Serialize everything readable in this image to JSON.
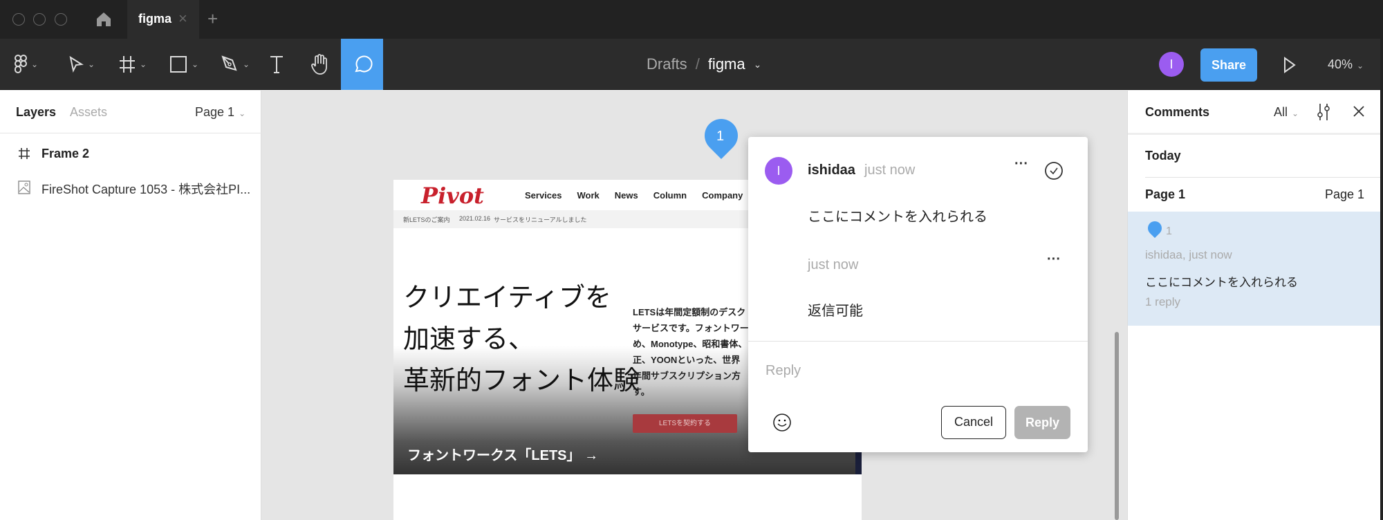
{
  "tabbar": {
    "tab_title": "figma",
    "close": "×",
    "new_tab": "+"
  },
  "toolbar": {
    "breadcrumb_parent": "Drafts",
    "separator": "/",
    "file_name": "figma",
    "avatar_initial": "I",
    "share_label": "Share",
    "zoom": "40%",
    "accent": "#4a9ff0",
    "avatar_color": "#9b5cf0"
  },
  "left_panel": {
    "tabs": [
      "Layers",
      "Assets"
    ],
    "page_selector": "Page 1",
    "layers": [
      {
        "icon": "frame-icon",
        "name": "Frame 2"
      },
      {
        "icon": "image-icon",
        "name": "FireShot Capture 1053 - 株式会社PI..."
      }
    ]
  },
  "canvas": {
    "pin_number": "1",
    "webpage": {
      "logo": "Pivot",
      "nav": [
        "Services",
        "Work",
        "News",
        "Column",
        "Company"
      ],
      "news_label": "新LETSのご案内",
      "news_date": "2021.02.16",
      "news_text": "サービスをリニューアルしました",
      "hero_lines": [
        "クリエイティブを",
        "加速する、",
        "革新的フォント体験"
      ],
      "body_lines": [
        "LETSは年間定額制のデスク",
        "サービスです。フォントワー",
        "め、Monotype、昭和書体、",
        "正、YOONといった、世界",
        "年間サブスクリプション方",
        "す。"
      ],
      "cta": "LETSを契約する",
      "banner": "フォントワークス「LETS」 →"
    }
  },
  "comment_popup": {
    "author": "ishidaa",
    "author_initial": "I",
    "time": "just now",
    "comment": "ここにコメントを入れられる",
    "reply_time": "just now",
    "reply_text": "返信可能",
    "reply_placeholder": "Reply",
    "cancel_label": "Cancel",
    "reply_label": "Reply"
  },
  "comments_panel": {
    "title": "Comments",
    "filter": "All",
    "section": "Today",
    "page_left": "Page 1",
    "page_right": "Page 1",
    "thread": {
      "number": "1",
      "meta": "ishidaa, just now",
      "text": "ここにコメントを入れられる",
      "replies": "1 reply"
    }
  }
}
